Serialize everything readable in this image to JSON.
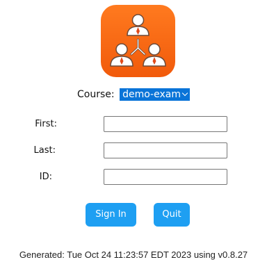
{
  "app": {
    "logo_icon": "org-chart-people-icon",
    "logo_color": "#f15a0b"
  },
  "course": {
    "label": "Course:",
    "selected": "demo-exam",
    "select_color": "#0a74d8"
  },
  "form": {
    "first_label": "First:",
    "first_value": "",
    "last_label": "Last:",
    "last_value": "",
    "id_label": "ID:",
    "id_value": ""
  },
  "buttons": {
    "sign_in_label": "Sign In",
    "quit_label": "Quit",
    "button_color": "#1e9ff2"
  },
  "footer": {
    "text": "Generated: Tue Oct 24 11:23:57 EDT 2023 using v0.8.27"
  }
}
